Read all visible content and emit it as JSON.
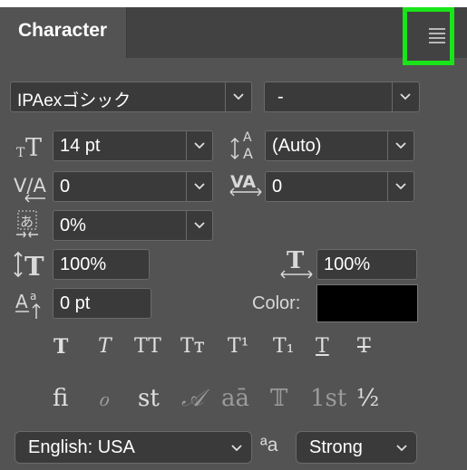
{
  "panel": {
    "tab_label": "Character",
    "menu_icon": "panel-menu-icon"
  },
  "font": {
    "family": "IPAexゴシック",
    "style": "-"
  },
  "size": {
    "font_size": "14 pt",
    "leading": "(Auto)"
  },
  "spacing": {
    "kerning": "0",
    "tracking": "0",
    "tsume": "0%"
  },
  "scale": {
    "vertical": "100%",
    "horizontal": "100%"
  },
  "baseline": {
    "shift": "0 pt",
    "color_label": "Color:",
    "color": "#000000"
  },
  "style_buttons": [
    {
      "glyph": "T",
      "name": "faux-bold"
    },
    {
      "glyph": "T",
      "name": "faux-italic"
    },
    {
      "glyph": "TT",
      "name": "all-caps"
    },
    {
      "glyph": "Tт",
      "name": "small-caps"
    },
    {
      "glyph": "T¹",
      "name": "superscript"
    },
    {
      "glyph": "T₁",
      "name": "subscript"
    },
    {
      "glyph": "T",
      "name": "underline"
    },
    {
      "glyph": "T",
      "name": "strikethrough"
    }
  ],
  "opentype": {
    "ligatures": "fi",
    "old_style": "ℴ",
    "discretionary": "st",
    "swash": "𝒜",
    "titling": "aā",
    "contextual": "𝕋",
    "ordinals": "1st",
    "fractions": "½"
  },
  "language": {
    "value": "English: USA",
    "aa_icon": "ªa",
    "antialias": "Strong"
  }
}
